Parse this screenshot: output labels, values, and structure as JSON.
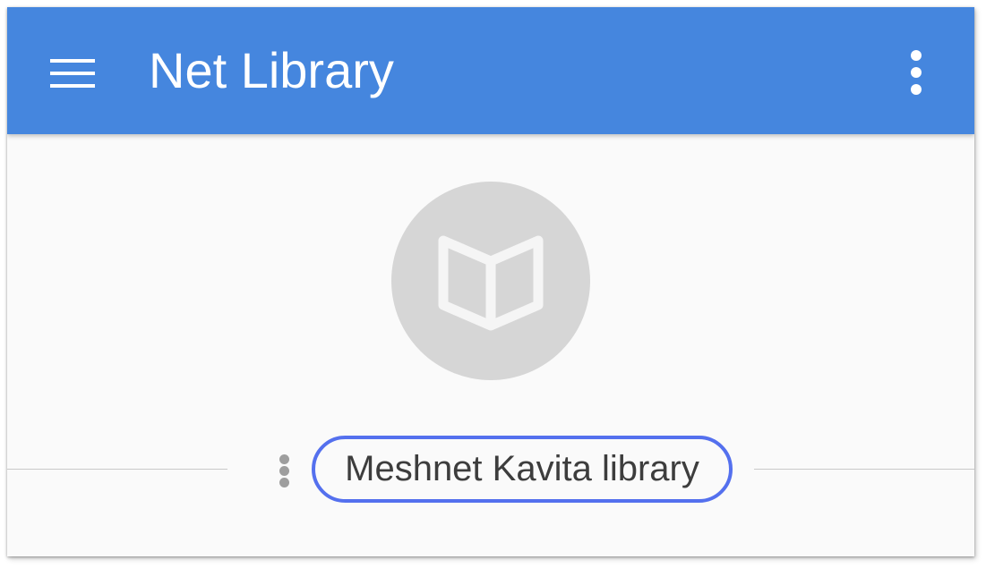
{
  "app_bar": {
    "title": "Net Library",
    "background_color": "#4586de",
    "menu_icon": "hamburger-menu-icon",
    "overflow_icon": "more-vert-icon"
  },
  "library": {
    "icon": "open-book-icon",
    "name": "Meshnet Kavita library",
    "options_icon": "more-vert-icon",
    "highlight_color": "#5470ee"
  }
}
